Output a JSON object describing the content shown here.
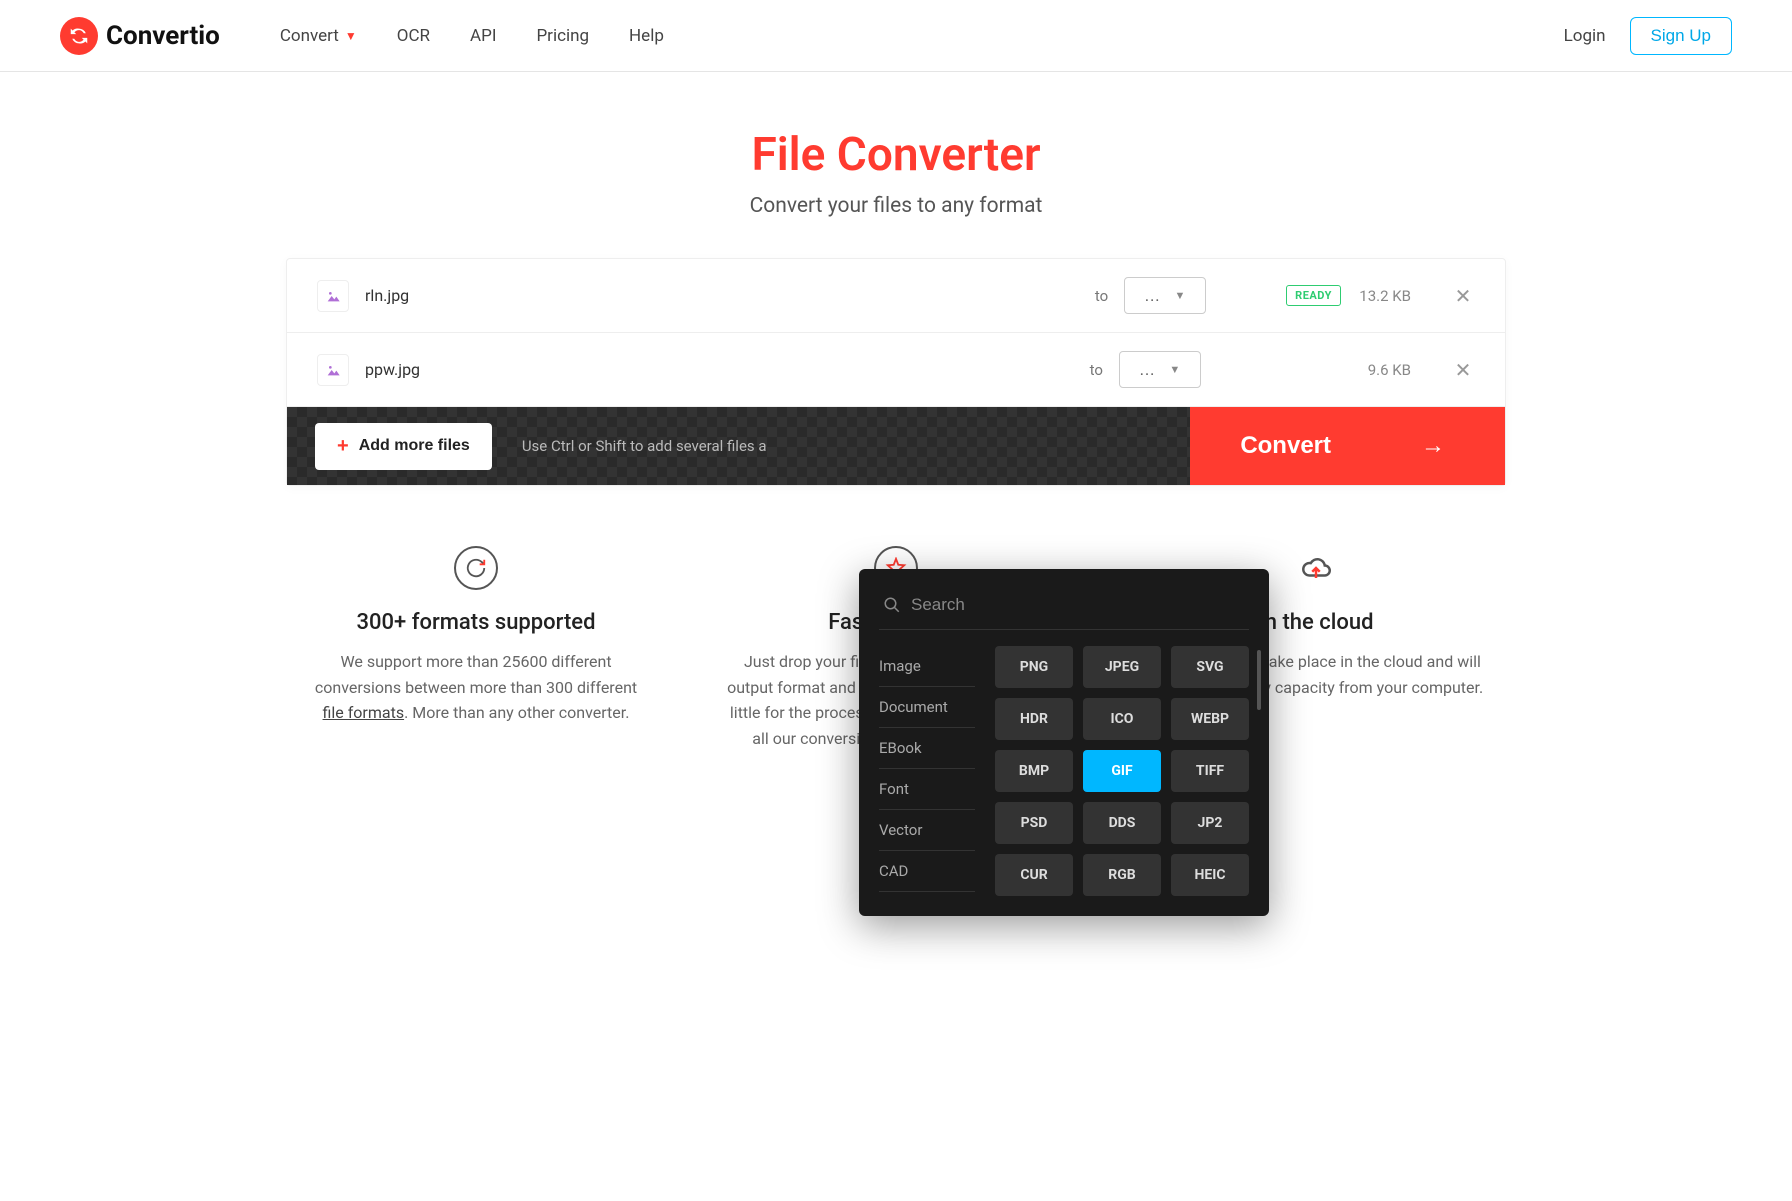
{
  "brand": "Convertio",
  "nav": {
    "convert": "Convert",
    "ocr": "OCR",
    "api": "API",
    "pricing": "Pricing",
    "help": "Help"
  },
  "auth": {
    "login": "Login",
    "signup": "Sign Up"
  },
  "hero": {
    "title": "File Converter",
    "subtitle": "Convert your files to any format"
  },
  "files": [
    {
      "name": "rln.jpg",
      "to": "to",
      "dots": "...",
      "status": "READY",
      "size": "13.2 KB"
    },
    {
      "name": "ppw.jpg",
      "to": "to",
      "dots": "...",
      "status": "",
      "size": "9.6 KB"
    }
  ],
  "actions": {
    "add_more": "Add more files",
    "hint": "Use Ctrl or Shift to add several files a",
    "convert": "Convert"
  },
  "dropdown": {
    "search_placeholder": "Search",
    "categories": [
      "Image",
      "Document",
      "EBook",
      "Font",
      "Vector",
      "CAD"
    ],
    "formats": [
      "PNG",
      "JPEG",
      "SVG",
      "HDR",
      "ICO",
      "WEBP",
      "BMP",
      "GIF",
      "TIFF",
      "PSD",
      "DDS",
      "JP2",
      "CUR",
      "RGB",
      "HEIC"
    ],
    "active_format": "GIF"
  },
  "features": [
    {
      "title": "300+ formats supported",
      "text_pre": "We support more than 25600 different conversions between more than 300 different ",
      "link": "file formats",
      "text_post": ". More than any other converter."
    },
    {
      "title": "Fast and easy",
      "text_pre": "Just drop your files on the page, choose an output format and click \"Convert\" button. Wait a little for the process to complete. We aim to do all our conversions in under 1-2 minutes.",
      "link": "",
      "text_post": ""
    },
    {
      "title": "In the cloud",
      "text_pre": "All conversions take place in the cloud and will not consume any capacity from your computer.",
      "link": "",
      "text_post": ""
    }
  ]
}
